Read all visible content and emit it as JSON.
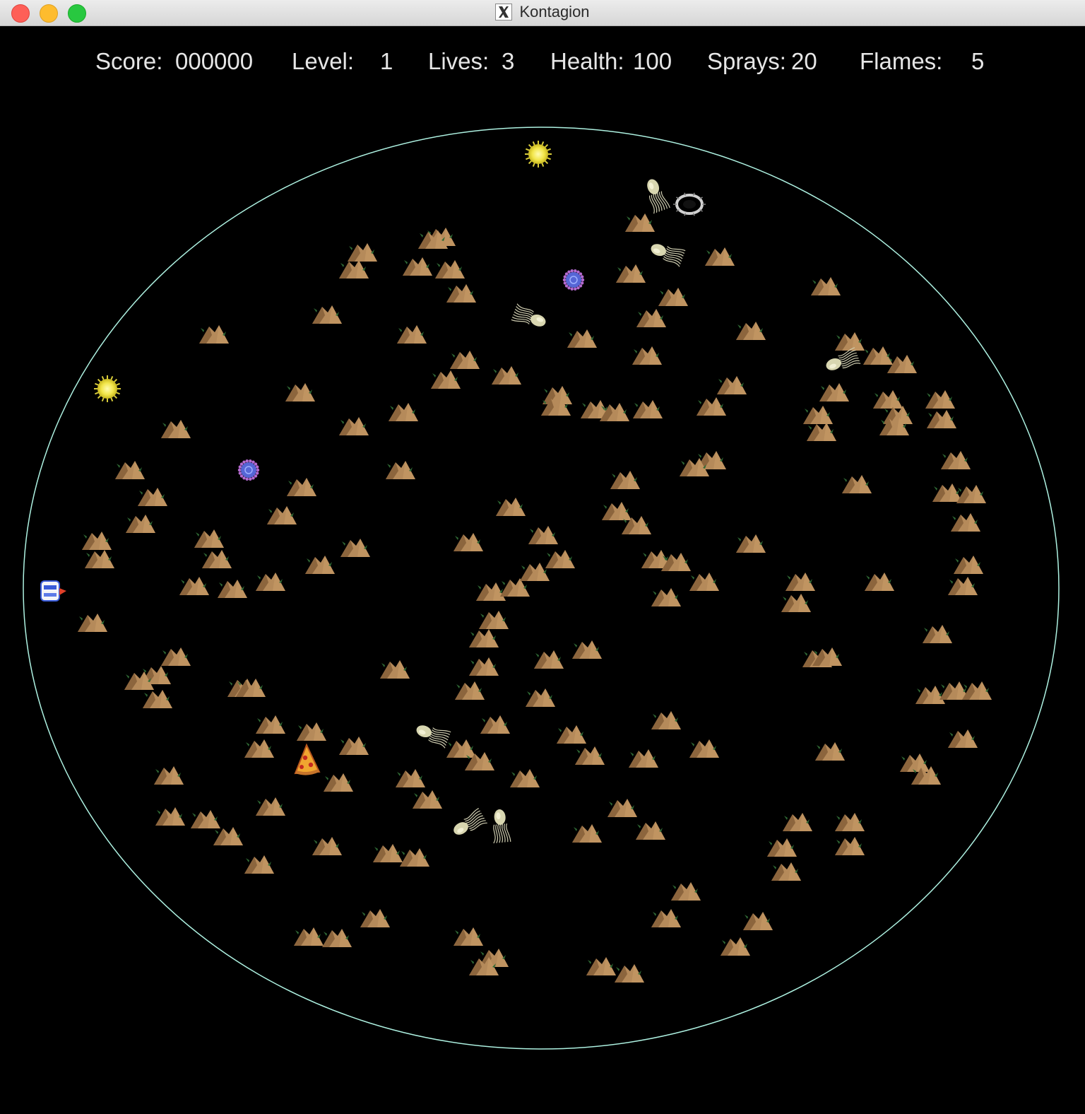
{
  "window": {
    "title": "Kontagion",
    "app_icon": "x11-icon",
    "controls": [
      "close-button",
      "minimize-button",
      "zoom-button"
    ]
  },
  "hud": {
    "score_label": "Score:",
    "score_value": "000000",
    "level_label": "Level:",
    "level_value": "1",
    "lives_label": "Lives:",
    "lives_value": "3",
    "health_label": "Health:",
    "health_value": "100",
    "sprays_label": "Sprays:",
    "sprays_value": "20",
    "flames_label": "Flames:",
    "flames_value": "5"
  },
  "colors": {
    "background": "#000000",
    "petri_dish_outline": "#aef2e2",
    "hud_text": "#e6e6e6",
    "dirt": "#b58a5a",
    "dirt_shadow": "#7a5530",
    "moss": "#2f6a35",
    "goodie_yellow": "#f2e64a",
    "fungus_blue": "#5666d6",
    "bacteria_pale": "#d8d6b0"
  },
  "entities": {
    "player": "socrates-player-icon",
    "goodies": [
      "restore-health-goodie-icon",
      "restore-health-goodie-icon"
    ],
    "fungus": [
      "fungus-icon",
      "fungus-icon"
    ],
    "pit": "bacterial-pit-icon",
    "food": "pizza-food-icon",
    "bacteria": "e-coli-bacterium-icon",
    "dirt": "dirt-pile-icon"
  }
}
